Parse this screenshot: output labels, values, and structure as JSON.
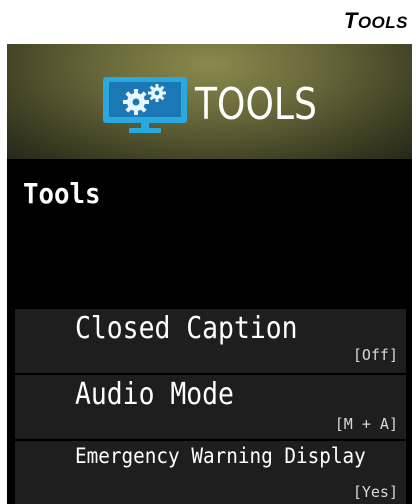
{
  "page_header": {
    "title_first": "T",
    "title_rest": "OOLS"
  },
  "banner": {
    "title": "TOOLS",
    "icon": "tools-monitor-gear-icon"
  },
  "section": {
    "title": "Tools"
  },
  "menu": {
    "items": [
      {
        "label": "Closed Caption",
        "value": "[Off]"
      },
      {
        "label": "Audio Mode",
        "value": "[M + A]"
      },
      {
        "label": "Emergency Warning Display",
        "value": "[Yes]"
      }
    ]
  },
  "colors": {
    "banner_highlight": "#8a8a4c",
    "banner_dark": "#26271a",
    "menu_item_bg": "#1e1e1e",
    "screen_bg": "#000000",
    "icon_blue": "#2aa9e0"
  }
}
